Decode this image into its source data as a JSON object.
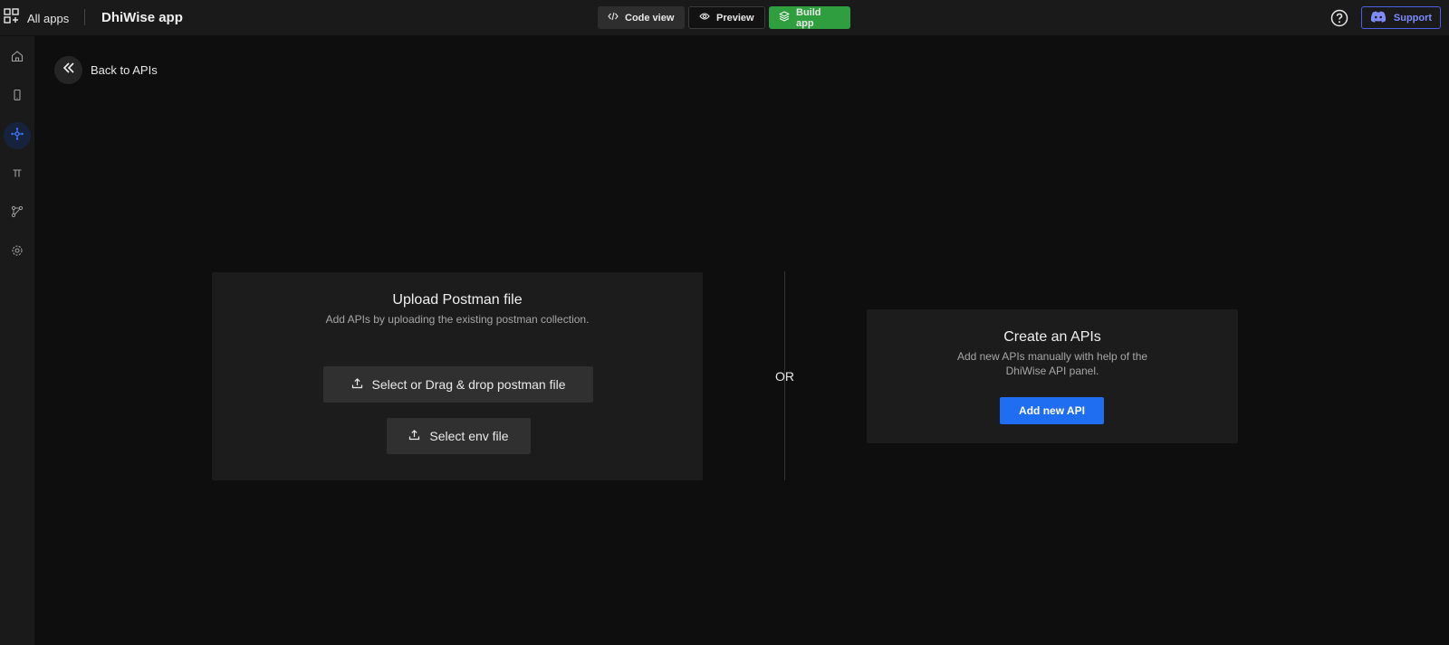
{
  "topbar": {
    "all_apps_label": "All apps",
    "app_title": "DhiWise app",
    "modes": {
      "code_view": "Code view",
      "preview": "Preview",
      "build_app": "Build app"
    },
    "support_label": "Support"
  },
  "sidebar": {
    "items": [
      {
        "icon": "home-icon"
      },
      {
        "icon": "mobile-icon"
      },
      {
        "icon": "api-icon",
        "active": true
      },
      {
        "icon": "pi-icon"
      },
      {
        "icon": "flow-icon"
      },
      {
        "icon": "settings-icon"
      }
    ]
  },
  "back": {
    "label": "Back to APIs"
  },
  "upload_card": {
    "title": "Upload Postman file",
    "description": "Add APIs by uploading the existing postman collection.",
    "postman_button": "Select or Drag & drop postman file",
    "env_button": "Select env file"
  },
  "separator": "OR",
  "create_card": {
    "title": "Create an APIs",
    "description": "Add new APIs manually with help of the DhiWise API panel.",
    "add_button": "Add new API"
  },
  "colors": {
    "background": "#0e0e0e",
    "panel": "#1c1c1c",
    "build_green": "#2f9e3f",
    "primary_blue": "#1f6df1",
    "support_blue": "#4f5ee6"
  }
}
